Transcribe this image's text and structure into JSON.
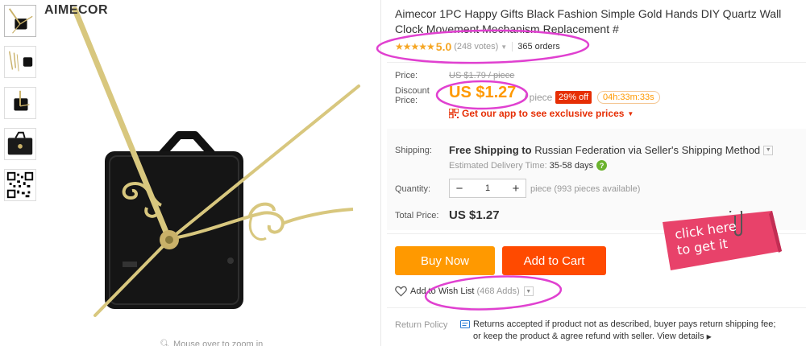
{
  "gallery": {
    "brand": "AIMECOR",
    "zoom_hint": "Mouse over to zoom in"
  },
  "product": {
    "title": "Aimecor 1PC Happy Gifts Black Fashion Simple Gold Hands DIY Quartz Wall Clock Movement Mechanism Replacement #"
  },
  "rating": {
    "stars": "★★★★★",
    "score": "5.0",
    "votes": "(248 votes)",
    "orders": "365 orders"
  },
  "price": {
    "price_label": "Price:",
    "original": "US $1.79 / piece",
    "discount_label_1": "Discount",
    "discount_label_2": "Price:",
    "discount": "US $1.27",
    "per_piece": "/ piece",
    "off_badge": "29% off",
    "timer": "04h:33m:33s",
    "app_promo": "Get our app to see exclusive prices"
  },
  "shipping": {
    "label": "Shipping:",
    "free_text": "Free Shipping to",
    "destination": "Russian Federation via Seller's Shipping Method",
    "delivery_label": "Estimated Delivery Time:",
    "delivery_days": "35-58 days"
  },
  "quantity": {
    "label": "Quantity:",
    "value": "1",
    "available": "piece (993 pieces available)"
  },
  "total": {
    "label": "Total Price:",
    "value": "US $1.27"
  },
  "actions": {
    "buy_now": "Buy Now",
    "add_to_cart": "Add to Cart",
    "wishlist": "Add to Wish List",
    "wishlist_adds": "(468 Adds)"
  },
  "sticker": {
    "line1": "click here",
    "line2": "to get it"
  },
  "return_policy": {
    "label": "Return Policy",
    "line1": "Returns accepted if product not as described, buyer pays return shipping fee;",
    "line2": "or keep the product & agree refund with seller.",
    "view_details": "View details"
  },
  "colors": {
    "orange": "#ff9900",
    "cart_red": "#ff4a00",
    "badge_red": "#e62e04",
    "highlight": "#e040d0",
    "sticker_pink": "#e8426a"
  }
}
